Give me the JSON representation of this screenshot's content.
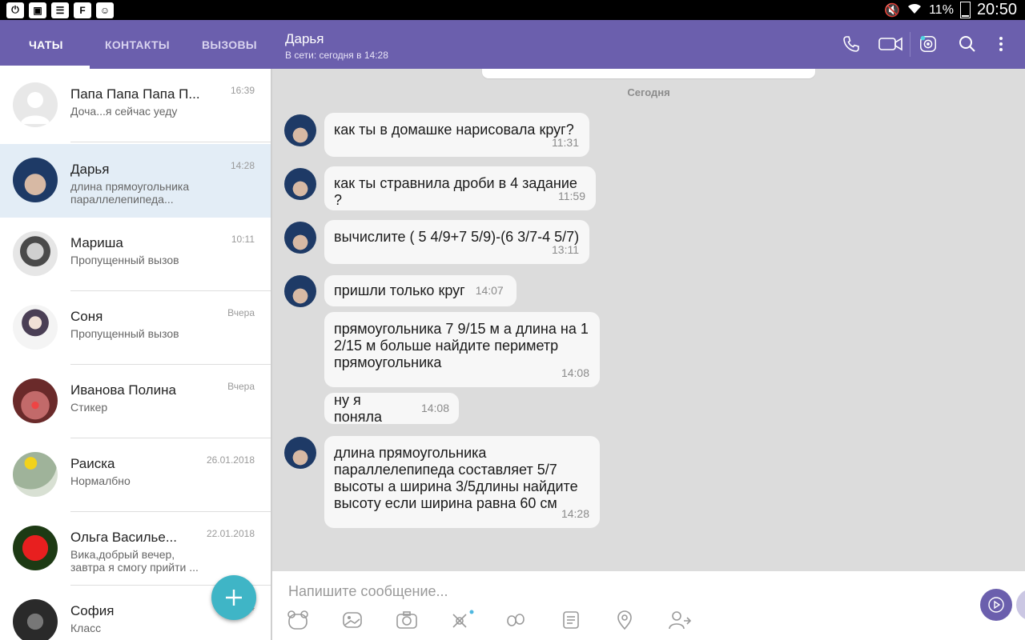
{
  "status_bar": {
    "battery": "11%",
    "time": "20:50"
  },
  "tabs": [
    {
      "label": "ЧАТЫ"
    },
    {
      "label": "КОНТАКТЫ"
    },
    {
      "label": "ВЫЗОВЫ"
    }
  ],
  "chat_header": {
    "name": "Дарья",
    "status": "В сети: сегодня в 14:28"
  },
  "chats": [
    {
      "name": "Папа Папа Папа П...",
      "time": "16:39",
      "preview": "Доча...я сейчас уеду"
    },
    {
      "name": "Дарья",
      "time": "14:28",
      "preview": "длина прямоугольника параллелепипеда..."
    },
    {
      "name": "Мариша",
      "time": "10:11",
      "preview": "Пропущенный вызов"
    },
    {
      "name": "Соня",
      "time": "Вчера",
      "preview": "Пропущенный вызов"
    },
    {
      "name": "Иванова Полина",
      "time": "Вчера",
      "preview": "Стикер"
    },
    {
      "name": "Раиска",
      "time": "26.01.2018",
      "preview": "Нормалбно"
    },
    {
      "name": "Ольга Василье...",
      "time": "22.01.2018",
      "preview": "Вика,добрый вечер, завтра я смогу прийти ..."
    },
    {
      "name": "София",
      "time": "14",
      "preview": "Класс"
    }
  ],
  "conversation": {
    "day_separator": "Сегодня",
    "messages": [
      {
        "text": "как ты в домашке  нарисовала круг?",
        "time": "11:31"
      },
      {
        "text": "как ты стравнила дроби в 4 задание ?",
        "time": "11:59"
      },
      {
        "text": "вычислите ( 5 4/9+7  5/9)-(6 3/7-4 5/7)",
        "time": "13:11"
      },
      {
        "text": "пришли только круг",
        "time": "14:07"
      },
      {
        "text": "прямоугольника 7 9/15 м а длина на 1 2/15 м больше найдите периметр прямоугольника",
        "time": "14:08"
      },
      {
        "text": "ну я поняла",
        "time": "14:08"
      },
      {
        "text": "длина прямоугольника параллелепипеда составляет 5/7 высоты а ширина 3/5длины найдите высоту если ширина равна 60 см",
        "time": "14:28"
      }
    ]
  },
  "composer": {
    "placeholder": "Напишите сообщение..."
  },
  "colors": {
    "brand": "#6b5fad",
    "fab": "#3fb5c6",
    "selected_row": "#e3edf6"
  }
}
